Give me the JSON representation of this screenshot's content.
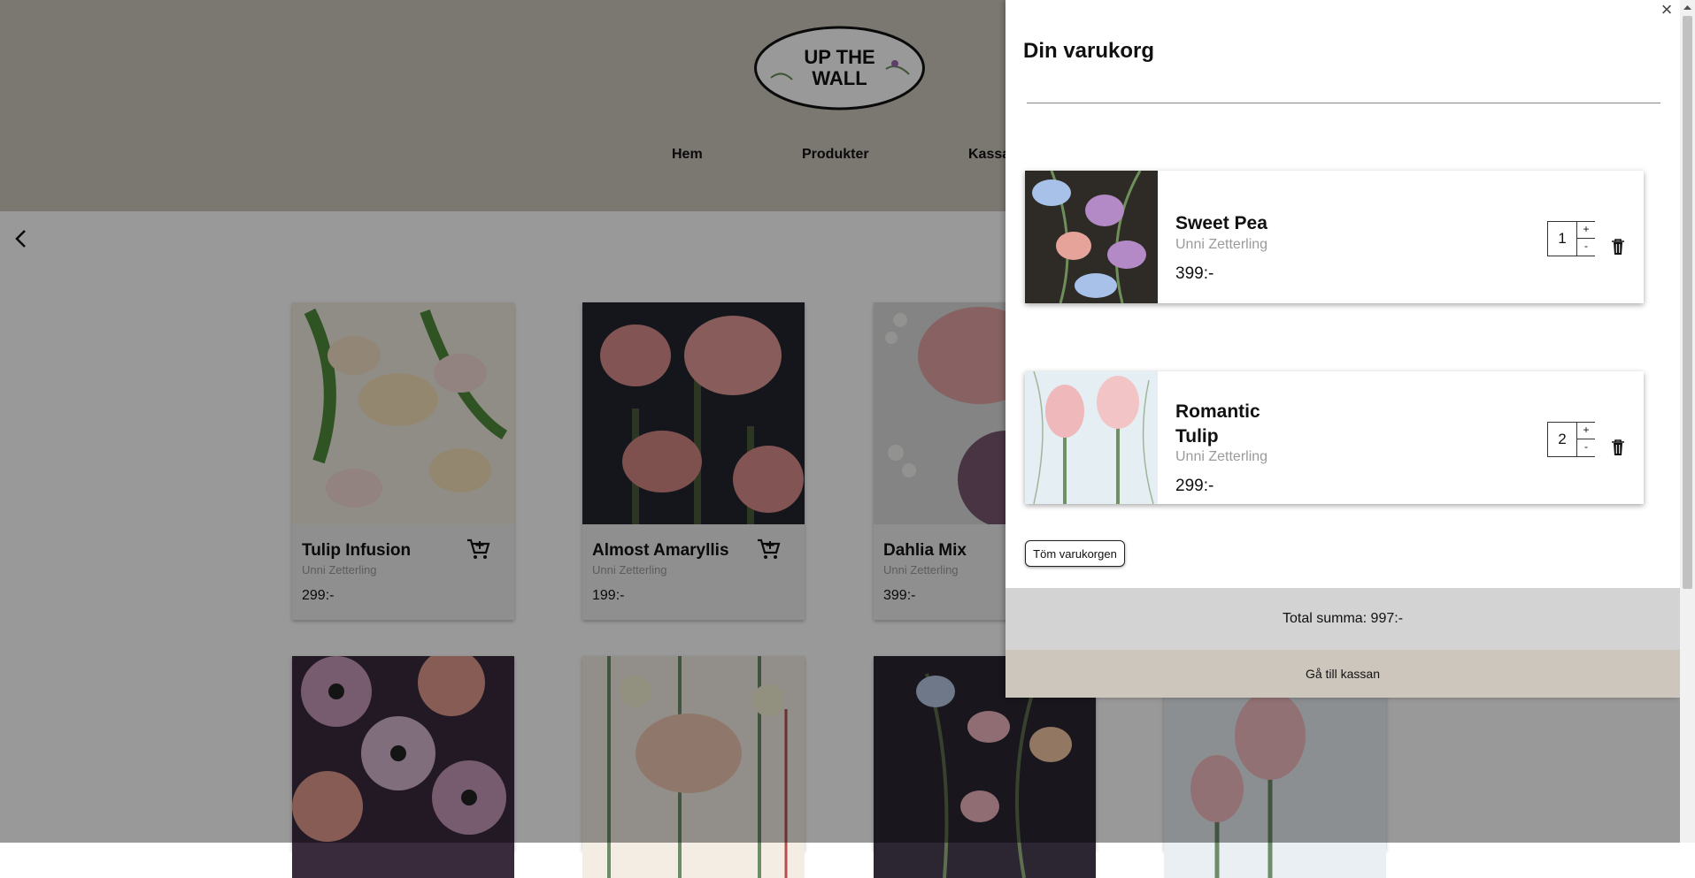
{
  "header": {
    "logo_line1": "UP THE",
    "logo_line2": "WALL",
    "nav": [
      "Hem",
      "Produkter",
      "Kassa"
    ]
  },
  "products": [
    {
      "name": "Tulip Infusion",
      "author": "Unni Zetterling",
      "price": "299:-"
    },
    {
      "name": "Almost Amaryllis",
      "author": "Unni Zetterling",
      "price": "199:-"
    },
    {
      "name": "Dahlia Mix",
      "author": "Unni Zetterling",
      "price": "399:-"
    }
  ],
  "cart": {
    "title": "Din varukorg",
    "close_icon": "×",
    "items": [
      {
        "name": "Sweet Pea",
        "author": "Unni Zetterling",
        "price": "399:-",
        "qty": "1",
        "plus": "+",
        "minus": "-"
      },
      {
        "name": "Romantic Tulip",
        "author": "Unni Zetterling",
        "price": "299:-",
        "qty": "2",
        "plus": "+",
        "minus": "-"
      }
    ],
    "empty_label": "Töm varukorgen",
    "total": "Total summa: 997:-",
    "checkout_label": "Gå till kassan"
  },
  "colors": {
    "header_bg": "#cdc6bc",
    "checkout_bg": "#cdc6bc",
    "total_bg": "#d3d3d3"
  }
}
